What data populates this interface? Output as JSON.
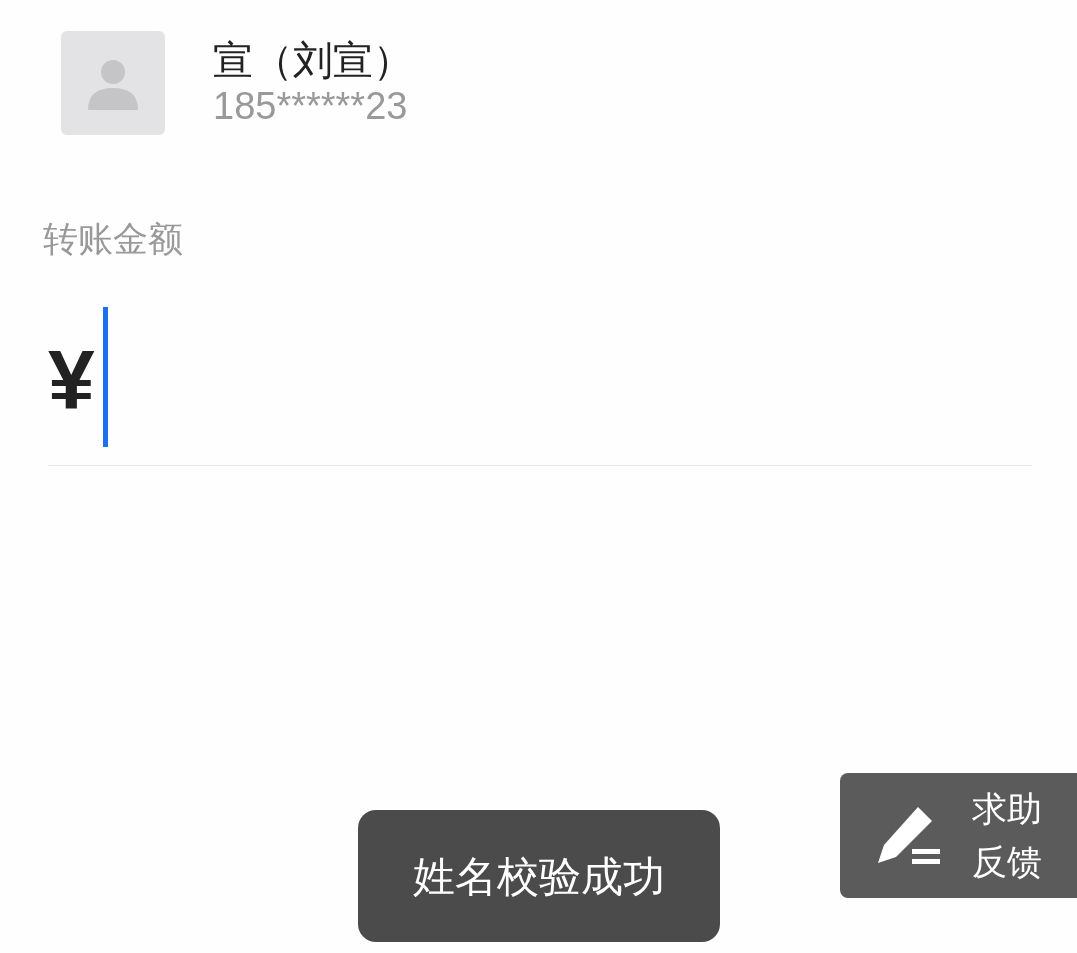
{
  "recipient": {
    "name": "宣（刘宣）",
    "phone": "185******23"
  },
  "amount": {
    "label": "转账金额",
    "currency": "¥"
  },
  "toast": {
    "text": "姓名校验成功"
  },
  "feedback_button": {
    "lines": [
      "求助",
      "反馈"
    ]
  }
}
